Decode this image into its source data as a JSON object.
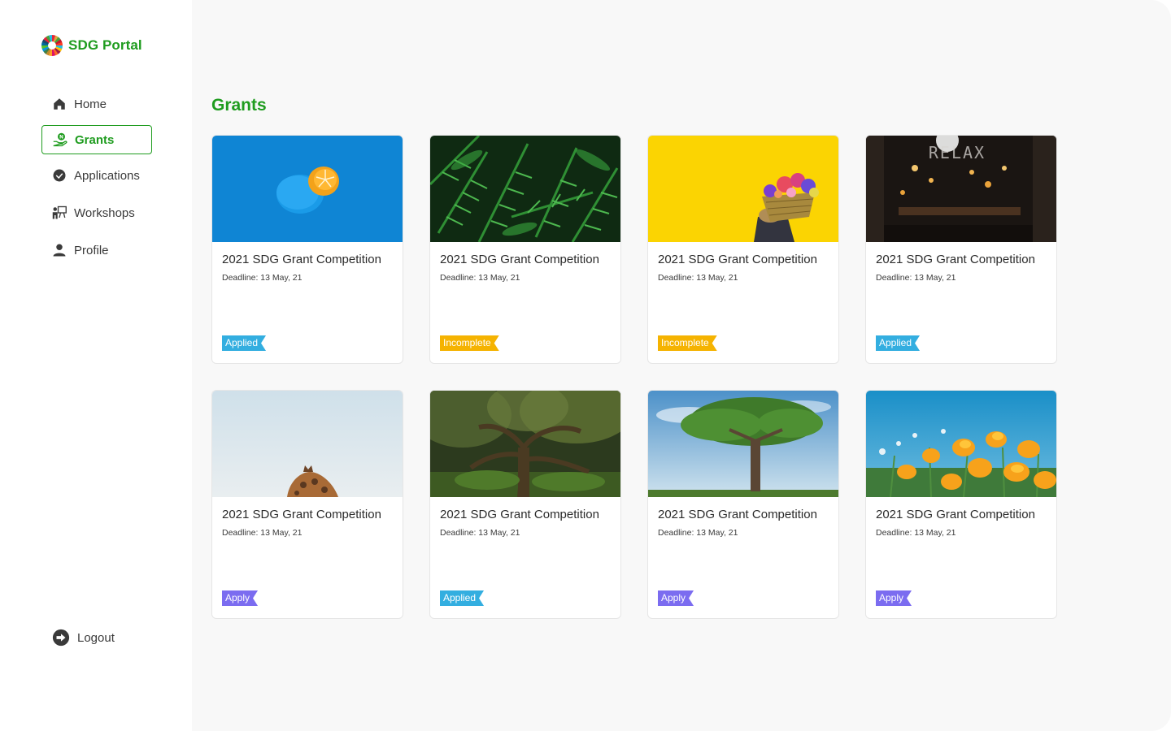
{
  "brand": {
    "name": "SDG Portal",
    "logo_icon": "sdg-wheel-icon"
  },
  "sidebar": {
    "items": [
      {
        "label": "Home",
        "icon": "home-icon",
        "active": false
      },
      {
        "label": "Grants",
        "icon": "grant-hand-icon",
        "active": true
      },
      {
        "label": "Applications",
        "icon": "check-circle-icon",
        "active": false
      },
      {
        "label": "Workshops",
        "icon": "presentation-icon",
        "active": false
      },
      {
        "label": "Profile",
        "icon": "user-icon",
        "active": false
      }
    ],
    "logout": {
      "label": "Logout",
      "icon": "logout-icon"
    }
  },
  "main": {
    "title": "Grants",
    "deadline_label": "Deadline:",
    "cards": [
      {
        "title": "2021 SDG Grant Competition",
        "deadline": "13 May, 21",
        "status": "Applied",
        "status_type": "applied",
        "image": "orange-on-blue"
      },
      {
        "title": "2021 SDG Grant Competition",
        "deadline": "13 May, 21",
        "status": "Incomplete",
        "status_type": "incomplete",
        "image": "fern-leaves"
      },
      {
        "title": "2021 SDG Grant Competition",
        "deadline": "13 May, 21",
        "status": "Incomplete",
        "status_type": "incomplete",
        "image": "flower-basket-yellow"
      },
      {
        "title": "2021 SDG Grant Competition",
        "deadline": "13 May, 21",
        "status": "Applied",
        "status_type": "applied",
        "image": "relax-cafe-night"
      },
      {
        "title": "2021 SDG Grant Competition",
        "deadline": "13 May, 21",
        "status": "Apply",
        "status_type": "apply",
        "image": "giraffe-sky"
      },
      {
        "title": "2021 SDG Grant Competition",
        "deadline": "13 May, 21",
        "status": "Applied",
        "status_type": "applied",
        "image": "forest-tree"
      },
      {
        "title": "2021 SDG Grant Competition",
        "deadline": "13 May, 21",
        "status": "Apply",
        "status_type": "apply",
        "image": "lone-tree-field"
      },
      {
        "title": "2021 SDG Grant Competition",
        "deadline": "13 May, 21",
        "status": "Apply",
        "status_type": "apply",
        "image": "yellow-poppies"
      }
    ]
  },
  "colors": {
    "brand_green": "#1f9c1f",
    "applied": "#33aee0",
    "incomplete": "#f5b301",
    "apply": "#7b6cf0",
    "main_bg": "#f8f8f8"
  }
}
